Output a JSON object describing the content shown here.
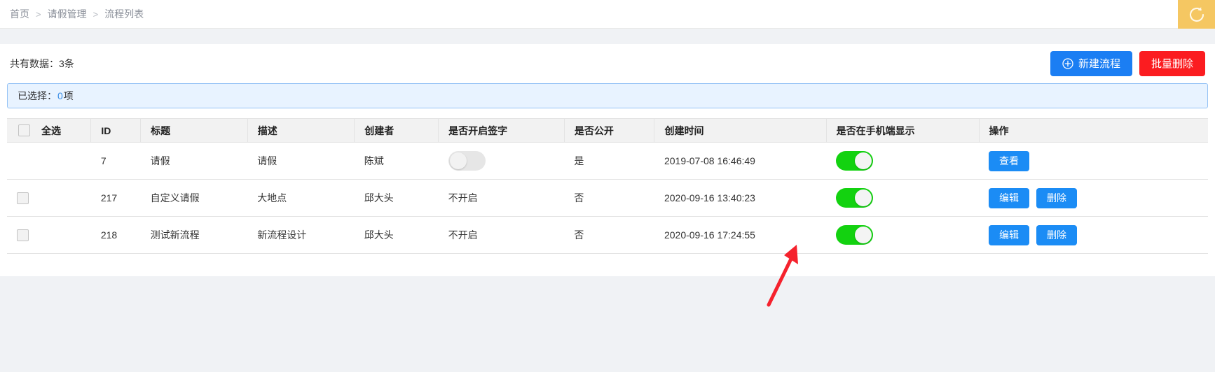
{
  "breadcrumb": {
    "items": [
      "首页",
      "请假管理",
      "流程列表"
    ],
    "separator": ">"
  },
  "header": {
    "avatar_icon": "refresh-circle-icon"
  },
  "toolbar": {
    "total_text": "共有数据：3条",
    "new_button": "新建流程",
    "new_button_icon": "plus-circle-icon",
    "delete_button": "批量删除",
    "primary_color": "#1b7ef3",
    "danger_color": "#fb1c20"
  },
  "selection": {
    "label_prefix": "已选择：",
    "count": "0",
    "label_suffix": "项",
    "accent_color": "#3a8ee6"
  },
  "table": {
    "columns": [
      "全选",
      "ID",
      "标题",
      "描述",
      "创建者",
      "是否开启签字",
      "是否公开",
      "创建时间",
      "是否在手机端显示",
      "操作"
    ],
    "rows": [
      {
        "has_checkbox": false,
        "checked": false,
        "id": "7",
        "title": "请假",
        "description": "请假",
        "creator": "陈斌",
        "sign_enabled_type": "switch",
        "sign_enabled_switch": "off",
        "sign_enabled_text": "",
        "public": "是",
        "created_at": "2019-07-08 16:46:49",
        "mobile_display": "on",
        "actions": [
          "查看"
        ]
      },
      {
        "has_checkbox": true,
        "checked": false,
        "id": "217",
        "title": "自定义请假",
        "description": "大地点",
        "creator": "邱大头",
        "sign_enabled_type": "text",
        "sign_enabled_switch": "",
        "sign_enabled_text": "不开启",
        "public": "否",
        "created_at": "2020-09-16 13:40:23",
        "mobile_display": "on",
        "actions": [
          "编辑",
          "删除"
        ]
      },
      {
        "has_checkbox": true,
        "checked": false,
        "id": "218",
        "title": "测试新流程",
        "description": "新流程设计",
        "creator": "邱大头",
        "sign_enabled_type": "text",
        "sign_enabled_switch": "",
        "sign_enabled_text": "不开启",
        "public": "否",
        "created_at": "2020-09-16 17:24:55",
        "mobile_display": "on",
        "actions": [
          "编辑",
          "删除"
        ]
      }
    ],
    "switch_on_color": "#13d210",
    "switch_off_color": "#e6e6e6",
    "row_button_color": "#1b8cf5"
  },
  "annotation": {
    "arrow_color": "#f5222d",
    "points_to": "是否在手机端显示 switch of last row"
  }
}
